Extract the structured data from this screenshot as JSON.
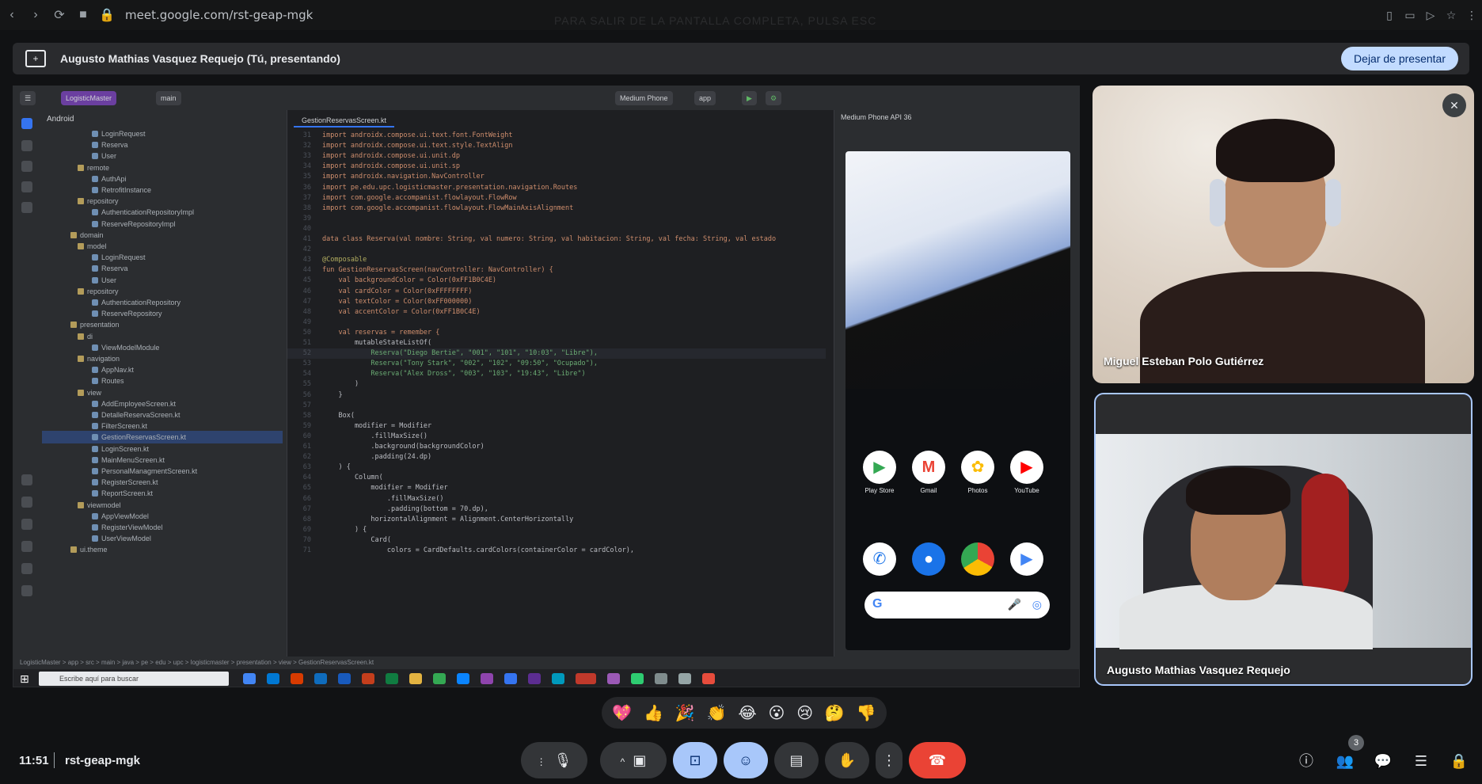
{
  "browser": {
    "url": "meet.google.com/rst-geap-mgk",
    "share_hint": "PARA SALIR DE LA PANTALLA COMPLETA, PULSA ESC"
  },
  "presenting_bar": {
    "presenter": "Augusto Mathias Vasquez Requejo (Tú, presentando)",
    "stop_label": "Dejar de presentar"
  },
  "ide": {
    "project": "LogisticMaster",
    "branch": "main",
    "device": "Medium Phone",
    "run_config": "app",
    "view": "Android",
    "active_tab": "GestionReservasScreen.kt",
    "emulator_title": "Medium Phone API 36",
    "tree": [
      {
        "label": "LoginRequest",
        "kind": "file",
        "indent": 7
      },
      {
        "label": "Reserva",
        "kind": "file",
        "indent": 7
      },
      {
        "label": "User",
        "kind": "file",
        "indent": 7
      },
      {
        "label": "remote",
        "kind": "folder",
        "indent": 5
      },
      {
        "label": "AuthApi",
        "kind": "file",
        "indent": 7
      },
      {
        "label": "RetrofitInstance",
        "kind": "file",
        "indent": 7
      },
      {
        "label": "repository",
        "kind": "folder",
        "indent": 5
      },
      {
        "label": "AuthenticationRepositoryImpl",
        "kind": "file",
        "indent": 7
      },
      {
        "label": "ReserveRepositoryImpl",
        "kind": "file",
        "indent": 7
      },
      {
        "label": "domain",
        "kind": "folder",
        "indent": 4
      },
      {
        "label": "model",
        "kind": "folder",
        "indent": 5
      },
      {
        "label": "LoginRequest",
        "kind": "file",
        "indent": 7
      },
      {
        "label": "Reserva",
        "kind": "file",
        "indent": 7
      },
      {
        "label": "User",
        "kind": "file",
        "indent": 7
      },
      {
        "label": "repository",
        "kind": "folder",
        "indent": 5
      },
      {
        "label": "AuthenticationRepository",
        "kind": "file",
        "indent": 7
      },
      {
        "label": "ReserveRepository",
        "kind": "file",
        "indent": 7
      },
      {
        "label": "presentation",
        "kind": "folder",
        "indent": 4
      },
      {
        "label": "di",
        "kind": "folder",
        "indent": 5
      },
      {
        "label": "ViewModelModule",
        "kind": "file",
        "indent": 7
      },
      {
        "label": "navigation",
        "kind": "folder",
        "indent": 5
      },
      {
        "label": "AppNav.kt",
        "kind": "file",
        "indent": 7
      },
      {
        "label": "Routes",
        "kind": "file",
        "indent": 7
      },
      {
        "label": "view",
        "kind": "folder",
        "indent": 5
      },
      {
        "label": "AddEmployeeScreen.kt",
        "kind": "file",
        "indent": 7
      },
      {
        "label": "DetalleReservaScreen.kt",
        "kind": "file",
        "indent": 7
      },
      {
        "label": "FilterScreen.kt",
        "kind": "file",
        "indent": 7
      },
      {
        "label": "GestionReservasScreen.kt",
        "kind": "file",
        "indent": 7,
        "selected": true
      },
      {
        "label": "LoginScreen.kt",
        "kind": "file",
        "indent": 7
      },
      {
        "label": "MainMenuScreen.kt",
        "kind": "file",
        "indent": 7
      },
      {
        "label": "PersonalManagmentScreen.kt",
        "kind": "file",
        "indent": 7
      },
      {
        "label": "RegisterScreen.kt",
        "kind": "file",
        "indent": 7
      },
      {
        "label": "ReportScreen.kt",
        "kind": "file",
        "indent": 7
      },
      {
        "label": "viewmodel",
        "kind": "folder",
        "indent": 5
      },
      {
        "label": "AppViewModel",
        "kind": "file",
        "indent": 7
      },
      {
        "label": "RegisterViewModel",
        "kind": "file",
        "indent": 7
      },
      {
        "label": "UserViewModel",
        "kind": "file",
        "indent": 7
      },
      {
        "label": "ui.theme",
        "kind": "folder",
        "indent": 4
      }
    ],
    "code": [
      "import androidx.compose.ui.text.font.FontWeight",
      "import androidx.compose.ui.text.style.TextAlign",
      "import androidx.compose.ui.unit.dp",
      "import androidx.compose.ui.unit.sp",
      "import androidx.navigation.NavController",
      "import pe.edu.upc.logisticmaster.presentation.navigation.Routes",
      "import com.google.accompanist.flowlayout.FlowRow",
      "import com.google.accompanist.flowlayout.FlowMainAxisAlignment",
      "",
      "",
      "data class Reserva(val nombre: String, val numero: String, val habitacion: String, val fecha: String, val estado",
      "",
      "@Composable",
      "fun GestionReservasScreen(navController: NavController) {",
      "    val backgroundColor = Color(0xFF1B0C4E)",
      "    val cardColor = Color(0xFFFFFFFF)",
      "    val textColor = Color(0xFF000000)",
      "    val accentColor = Color(0xFF1B0C4E)",
      "",
      "    val reservas = remember {",
      "        mutableStateListOf(",
      "            Reserva(\"Diego Bertie\", \"001\", \"101\", \"10:03\", \"Libre\"),",
      "            Reserva(\"Tony Stark\", \"002\", \"102\", \"09:50\", \"Ocupado\"),",
      "            Reserva(\"Alex Dross\", \"003\", \"103\", \"19:43\", \"Libre\")",
      "        )",
      "    }",
      "",
      "    Box(",
      "        modifier = Modifier",
      "            .fillMaxSize()",
      "            .background(backgroundColor)",
      "            .padding(24.dp)",
      "    ) {",
      "        Column(",
      "            modifier = Modifier",
      "                .fillMaxSize()",
      "                .padding(bottom = 70.dp),",
      "            horizontalAlignment = Alignment.CenterHorizontally",
      "        ) {",
      "            Card(",
      "                colors = CardDefaults.cardColors(containerColor = cardColor),"
    ],
    "first_line_number": 31,
    "breadcrumb": "LogisticMaster > app > src > main > java > pe > edu > upc > logisticmaster > presentation > view > GestionReservasScreen.kt",
    "taskbar_search": "Escribe aquí para buscar",
    "phone_apps_row1": [
      "Play Store",
      "Gmail",
      "Photos",
      "YouTube"
    ]
  },
  "participants": [
    {
      "name": "Miguel Esteban Polo Gutiérrez"
    },
    {
      "name": "Augusto Mathias Vasquez Requejo"
    }
  ],
  "reactions": [
    "💖",
    "👍",
    "🎉",
    "👏",
    "😂",
    "😮",
    "😢",
    "🤔",
    "👎"
  ],
  "bottom": {
    "time": "11:51",
    "meeting_code": "rst-geap-mgk",
    "people_count": "3"
  },
  "colors": {
    "accent": "#a8c7fa",
    "end_call": "#ea4335",
    "background": "#111214"
  }
}
